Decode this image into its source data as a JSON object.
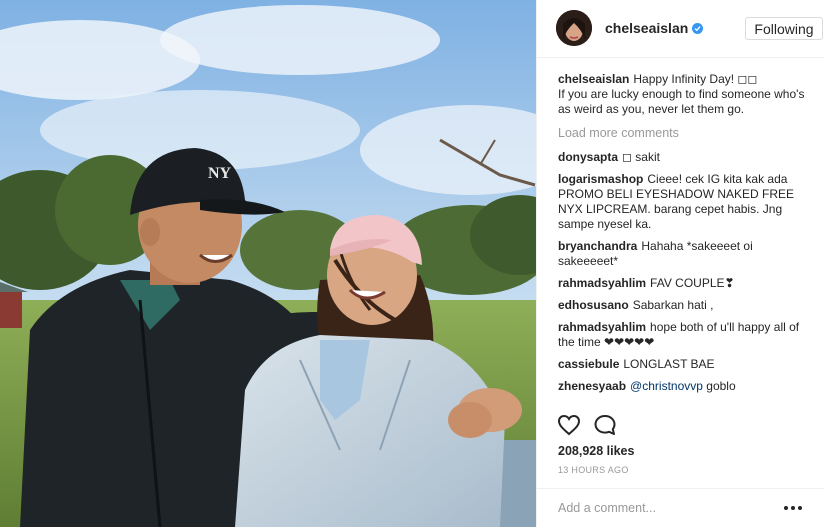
{
  "post": {
    "username": "chelseaislan",
    "follow_label": "Following",
    "caption_user": "chelseaislan",
    "caption_text": "Happy Infinity Day! ◻◻\nIf you are lucky enough to find someone who's as weird as you, never let them go.",
    "load_more": "Load more comments",
    "comments": [
      {
        "user": "donysapta",
        "text": "◻ sakit"
      },
      {
        "user": "logarismashop",
        "text": "Cieee! cek IG kita kak ada PROMO BELI EYESHADOW NAKED FREE NYX LIPCREAM. barang cepet habis. Jng sampe nyesel ka."
      },
      {
        "user": "bryanchandra",
        "text": "Hahaha *sakeeeet oi sakeeeeet*"
      },
      {
        "user": "rahmadsyahlim",
        "text": "FAV COUPLE❣"
      },
      {
        "user": "edhosusano",
        "text": "Sabarkan hati ,"
      },
      {
        "user": "rahmadsyahlim",
        "text": "hope both of u'll happy all of the time ❤❤❤❤❤"
      },
      {
        "user": "cassiebule",
        "text": "LONGLAST BAE"
      },
      {
        "user": "zhenesyaab",
        "mention": "@christnovvp",
        "text": "goblo"
      }
    ],
    "likes": "208,928 likes",
    "time": "13 HOURS AGO",
    "comment_placeholder": "Add a comment...",
    "icons": {
      "like": "heart-icon",
      "comment": "speech-bubble-icon",
      "options": "more-options-icon",
      "verified": "verified-badge-icon"
    },
    "colors": {
      "verified": "#3897f0",
      "mention": "#003569",
      "muted": "#999999"
    }
  }
}
